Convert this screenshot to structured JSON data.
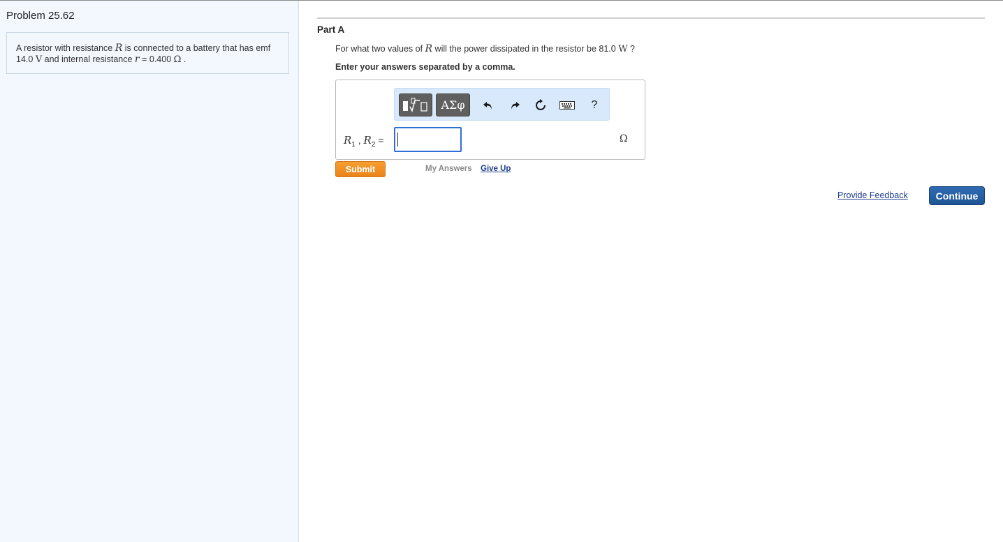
{
  "problem": {
    "title": "Problem 25.62",
    "text_part1": "A resistor with resistance ",
    "var_R": "R",
    "text_part2": " is connected to a battery that has emf 14.0 ",
    "unit_V": "V",
    "text_part3": " and internal resistance ",
    "var_r": "r",
    "text_part4": " = 0.400 ",
    "unit_ohm": "Ω",
    "text_part5": " ."
  },
  "part": {
    "title": "Part A",
    "question_part1": "For what two values of ",
    "question_var": "R",
    "question_part2": " will the power dissipated in the resistor be 81.0 ",
    "question_unit": "W",
    "question_part3": " ?",
    "instruction": "Enter your answers separated by a comma."
  },
  "toolbar": {
    "symbols_label": "ΑΣφ",
    "help_label": "?"
  },
  "answer": {
    "label_R1": "R",
    "label_sub1": "1",
    "label_sep": " , ",
    "label_R2": "R",
    "label_sub2": "2",
    "label_eq": " =",
    "value": "",
    "unit": "Ω"
  },
  "actions": {
    "submit": "Submit",
    "my_answers": "My Answers",
    "give_up": "Give Up",
    "provide_feedback": "Provide Feedback",
    "continue": "Continue"
  },
  "colors": {
    "submit_orange": "#f09022",
    "continue_blue": "#2a62a6",
    "link_blue": "#1d3e8c",
    "toolbar_bg": "#d7e9fb",
    "left_panel_bg": "#f3f8fe"
  }
}
